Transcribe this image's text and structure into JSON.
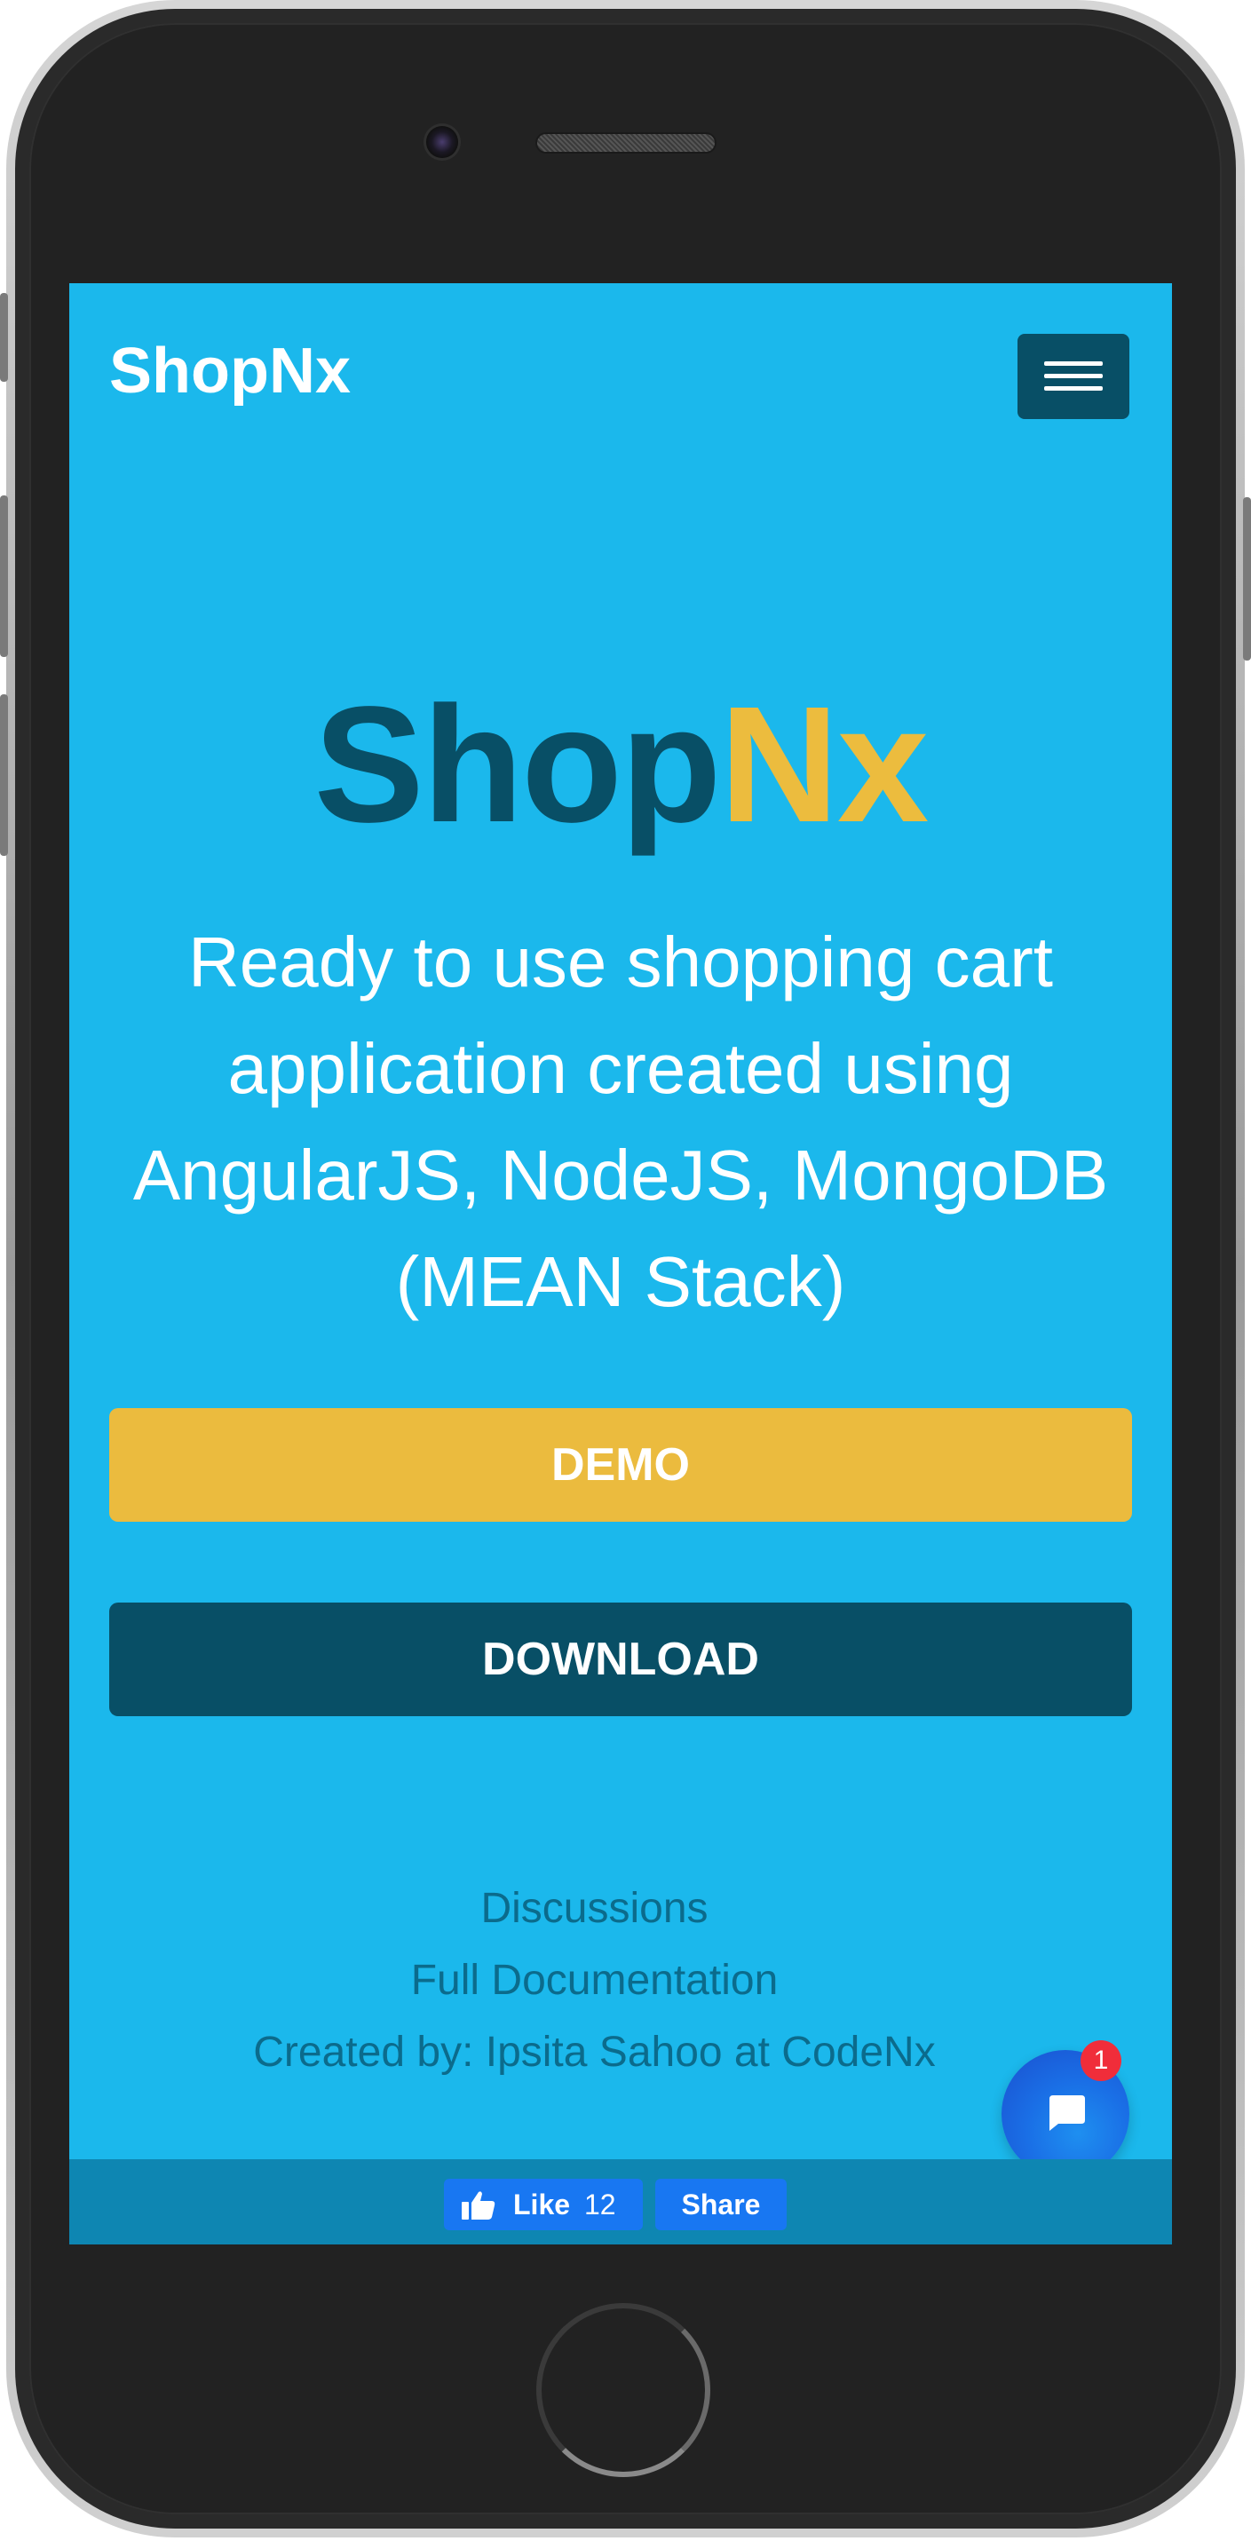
{
  "app": {
    "brand": "ShopNx"
  },
  "navbar": {
    "menu_icon": "hamburger-menu-icon"
  },
  "hero": {
    "title_part1": "Shop",
    "title_part2": "Nx",
    "title_part1_color": "#084f66",
    "title_part2_color": "#ecbc3e",
    "tagline": "Ready to use shopping cart application created using AngularJS, NodeJS, MongoDB (MEAN Stack)"
  },
  "buttons": {
    "demo_label": "DEMO",
    "download_label": "DOWNLOAD"
  },
  "footer": {
    "links": [
      "Discussions",
      "Full Documentation",
      "Created by: Ipsita Sahoo at CodeNx"
    ]
  },
  "chat": {
    "icon": "chat-icon",
    "badge_count": "1"
  },
  "share_bar": {
    "like_label": "Like",
    "like_count": "12",
    "share_label": "Share"
  },
  "colors": {
    "page_background": "#1bb8ec",
    "primary_dark": "#084f66",
    "accent_yellow": "#ebbb3e",
    "facebook_blue": "#1877f2"
  }
}
